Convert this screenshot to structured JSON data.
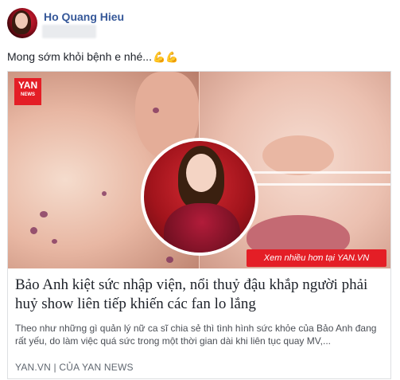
{
  "post": {
    "author": "Ho Quang Hieu",
    "message": "Mong sớm khỏi bệnh e nhé...",
    "message_emoji": "💪💪"
  },
  "link_card": {
    "logo_text": "YAN",
    "logo_sub": "NEWS",
    "banner_text": "Xem nhiều hơn tại YAN.VN",
    "headline": "Bảo Anh kiệt sức nhập viện, nổi thuỷ đậu khắp người phải huỷ show liên tiếp khiến các fan lo lắng",
    "description": "Theo như những gì quản lý nữ ca sĩ chia sẻ thì tình hình sức khỏe của Bảo Anh đang rất yếu, do làm việc quá sức trong một thời gian dài khi liên tục quay MV,...",
    "source": "YAN.VN | CỦA YAN NEWS"
  },
  "colors": {
    "author": "#365899",
    "brand_red": "#e41e26"
  }
}
